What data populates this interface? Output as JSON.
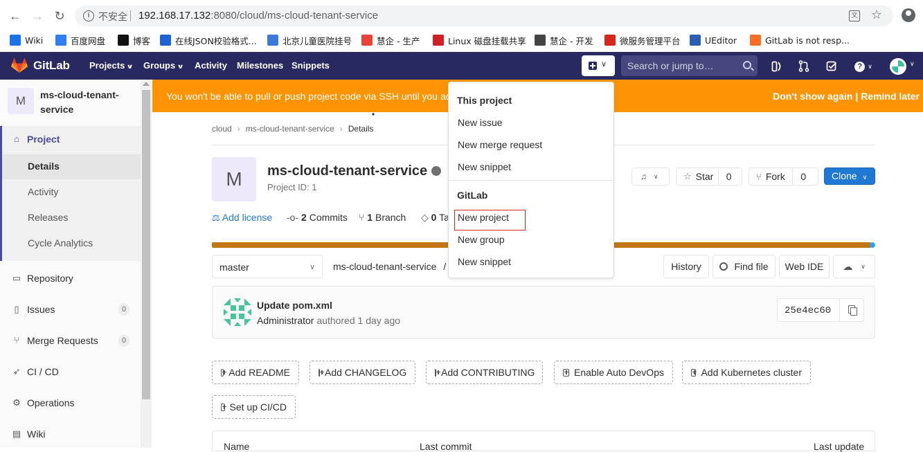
{
  "browser": {
    "insecure_label": "不安全",
    "url_host": "192.168.17.132",
    "url_rest": ":8080/cloud/ms-cloud-tenant-service",
    "bookmarks": [
      {
        "label": "Wiki",
        "color": "#1a73e8"
      },
      {
        "label": "百度网盘",
        "color": "#2f7ff2"
      },
      {
        "label": "博客",
        "color": "#111111"
      },
      {
        "label": "在线JSON校验格式...",
        "color": "#1e62d6"
      },
      {
        "label": "北京儿童医院挂号",
        "color": "#3b7ad6"
      },
      {
        "label": "慧企 - 生产",
        "color": "#e8433b"
      },
      {
        "label": "Linux 磁盘挂载共享",
        "color": "#d21f26"
      },
      {
        "label": "慧企 - 开发",
        "color": "#444444"
      },
      {
        "label": "微服务管理平台",
        "color": "#d9261c"
      },
      {
        "label": "UEditor",
        "color": "#2b5fb4"
      },
      {
        "label": "GitLab is not resp...",
        "color": "#fc6d26"
      }
    ]
  },
  "header": {
    "brand": "GitLab",
    "nav": [
      "Projects",
      "Groups",
      "Activity",
      "Milestones",
      "Snippets"
    ],
    "search_placeholder": "Search or jump to…",
    "bg_color": "#292961"
  },
  "sidebar": {
    "avatar_letter": "M",
    "project_name": "ms-cloud-tenant-service",
    "project_label": "Project",
    "sub_items": [
      "Details",
      "Activity",
      "Releases",
      "Cycle Analytics"
    ],
    "items": [
      {
        "label": "Repository",
        "count": null
      },
      {
        "label": "Issues",
        "count": "0"
      },
      {
        "label": "Merge Requests",
        "count": "0"
      },
      {
        "label": "CI / CD",
        "count": null
      },
      {
        "label": "Operations",
        "count": null
      },
      {
        "label": "Wiki",
        "count": null
      }
    ]
  },
  "banner": {
    "text": "You won't be able to pull or push project code via SSH until you add an SSH key to your profile",
    "dont_show": "Don't show again",
    "divider": "|",
    "remind": "Remind later",
    "color": "#fc9403"
  },
  "breadcrumb": [
    "cloud",
    "ms-cloud-tenant-service",
    "Details"
  ],
  "project": {
    "avatar_letter": "M",
    "title": "ms-cloud-tenant-service",
    "id_label": "Project ID: 1",
    "star_label": "Star",
    "star_count": "0",
    "fork_label": "Fork",
    "fork_count": "0",
    "clone_label": "Clone"
  },
  "stats": {
    "add_license": "Add license",
    "commits_num": "2",
    "commits_label": "Commits",
    "branch_num": "1",
    "branch_label": "Branch",
    "tags_num": "0",
    "tags_label": "Tags"
  },
  "toolbar": {
    "branch": "master",
    "path": "ms-cloud-tenant-service",
    "path_sep": "/",
    "history": "History",
    "find_file": "Find file",
    "web_ide": "Web IDE"
  },
  "commit": {
    "message": "Update pom.xml",
    "author": "Administrator",
    "authored": "authored",
    "time": "1 day ago",
    "sha": "25e4ec60"
  },
  "quick_actions": [
    "Add README",
    "Add CHANGELOG",
    "Add CONTRIBUTING",
    "Enable Auto DevOps",
    "Add Kubernetes cluster",
    "Set up CI/CD"
  ],
  "files_table": {
    "col_name": "Name",
    "col_commit": "Last commit",
    "col_update": "Last update"
  },
  "dropdown": {
    "section1": "This project",
    "section1_items": [
      "New issue",
      "New merge request",
      "New snippet"
    ],
    "section2": "GitLab",
    "section2_items": [
      "New project",
      "New group",
      "New snippet"
    ],
    "highlight_color": "#d9261c"
  }
}
